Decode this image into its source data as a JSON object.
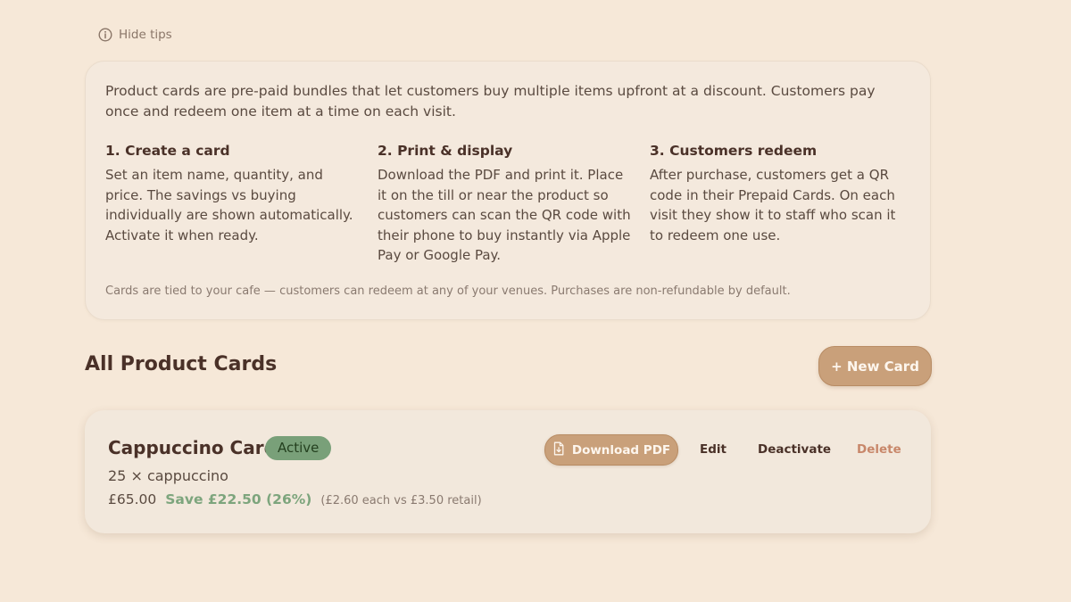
{
  "tips_toggle": {
    "label": "Hide tips",
    "icon": "info-icon"
  },
  "tips": {
    "intro": "Product cards are pre-paid bundles that let customers buy multiple items upfront at a discount. Customers pay once and redeem one item at a time on each visit.",
    "steps": [
      {
        "title": "1. Create a card",
        "body": "Set an item name, quantity, and price. The savings vs buying individually are shown automatically. Activate it when ready."
      },
      {
        "title": "2. Print & display",
        "body": "Download the PDF and print it. Place it on the till or near the product so customers can scan the QR code with their phone to buy instantly via Apple Pay or Google Pay."
      },
      {
        "title": "3. Customers redeem",
        "body": "After purchase, customers get a QR code in their Prepaid Cards. On each visit they show it to staff who scan it to redeem one use."
      }
    ],
    "footnote": "Cards are tied to your cafe — customers can redeem at any of your venues. Purchases are non-refundable by default."
  },
  "section": {
    "title": "All Product Cards",
    "new_card_label": "+ New Card"
  },
  "cards": [
    {
      "name": "Cappuccino Card",
      "status": "Active",
      "quantity": "25 × cappuccino",
      "price": "£65.00",
      "savings": "Save £22.50 (26%)",
      "detail": "(£2.60 each vs £3.50 retail)",
      "actions": {
        "download_pdf": "Download PDF",
        "edit": "Edit",
        "deactivate": "Deactivate",
        "delete": "Delete"
      },
      "download_icon": "file-download-icon"
    }
  ],
  "colors": {
    "background": "#f6e8d8",
    "accent": "#c9a07a",
    "active_badge": "#79a079",
    "savings_text": "#7da57d",
    "delete_text": "#c8876a"
  }
}
